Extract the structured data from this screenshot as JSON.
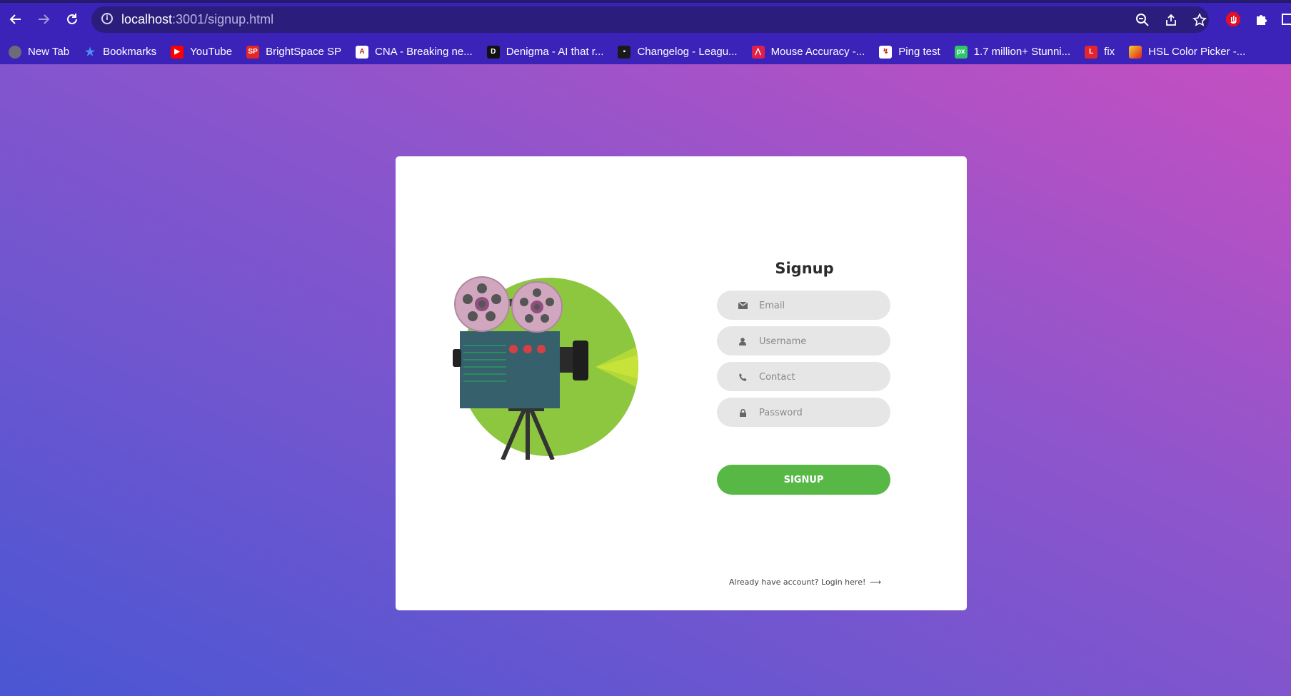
{
  "browser": {
    "url_host": "localhost",
    "url_path": ":3001/signup.html",
    "bookmarks": [
      {
        "label": "New Tab",
        "icon": "globe-icon",
        "color": "#6b6b7a"
      },
      {
        "label": "Bookmarks",
        "icon": "star-icon",
        "color": "#4d8ef7"
      },
      {
        "label": "YouTube",
        "icon": "youtube-icon",
        "color": "#ff0000"
      },
      {
        "label": "BrightSpace SP",
        "icon": "sp-icon",
        "color": "#e32626"
      },
      {
        "label": "CNA - Breaking ne...",
        "icon": "cna-icon",
        "color": "#ffffff"
      },
      {
        "label": "Denigma - AI that r...",
        "icon": "denigma-icon",
        "color": "#111111"
      },
      {
        "label": "Changelog - Leagu...",
        "icon": "changelog-icon",
        "color": "#1a1a1a"
      },
      {
        "label": "Mouse Accuracy -...",
        "icon": "mouse-accuracy-icon",
        "color": "#e0204a"
      },
      {
        "label": "Ping test",
        "icon": "ping-icon",
        "color": "#ffffff"
      },
      {
        "label": "1.7 million+ Stunni...",
        "icon": "pixabay-icon",
        "color": "#2ec66d"
      },
      {
        "label": "fix",
        "icon": "l-icon",
        "color": "#e3262d"
      },
      {
        "label": "HSL Color Picker -...",
        "icon": "hsl-icon",
        "color": "#f29a1c"
      }
    ],
    "bookmark_glyphs": [
      "",
      "★",
      "▶",
      "SP",
      "A",
      "D",
      "▪",
      "⋀",
      "↯",
      "px",
      "L",
      ""
    ]
  },
  "card": {
    "title": "Signup",
    "fields": {
      "email": {
        "placeholder": "Email",
        "value": ""
      },
      "username": {
        "placeholder": "Username",
        "value": ""
      },
      "contact": {
        "placeholder": "Contact",
        "value": ""
      },
      "password": {
        "placeholder": "Password",
        "value": ""
      }
    },
    "submit_label": "SIGNUP",
    "login_text": "Already have account? Login here!",
    "login_arrow": "⟶"
  },
  "colors": {
    "accent_green": "#57b846",
    "browser_bar": "#3b22b8",
    "circle_green": "#8dc63f",
    "camera_body": "#35606c",
    "reel": "#d1a6bf"
  }
}
